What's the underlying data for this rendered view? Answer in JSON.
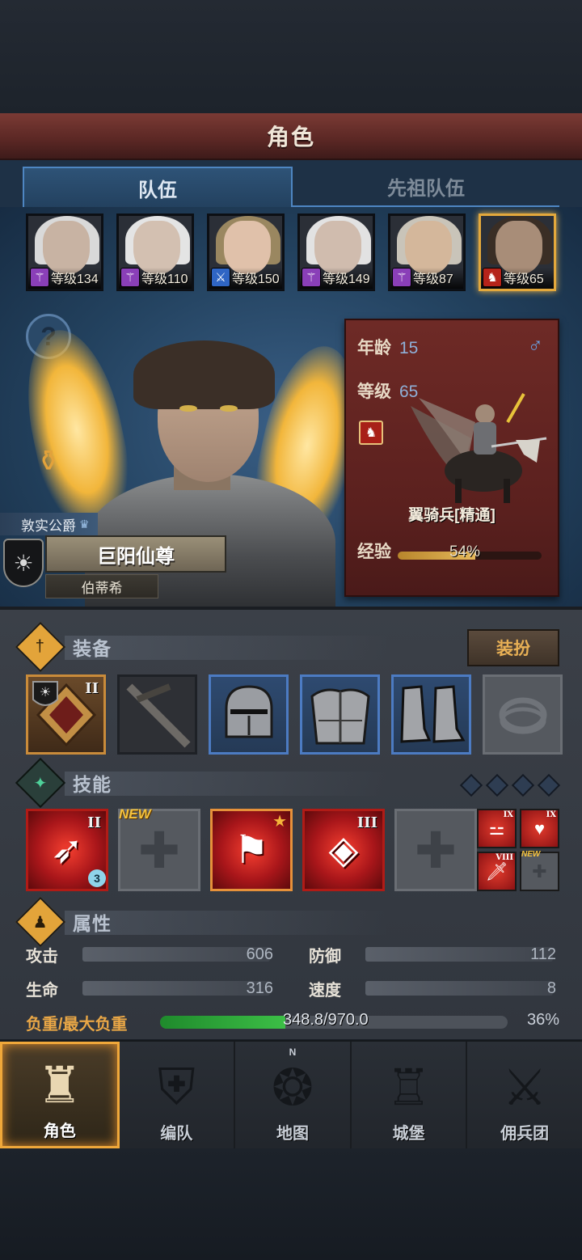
{
  "header": {
    "title": "角色"
  },
  "tabs": {
    "team": "队伍",
    "ancestor_team": "先祖队伍"
  },
  "roster": [
    {
      "level": "等级134",
      "class_icon": "staff-icon",
      "class_color": "#8a3fb8",
      "hair": "#d9d9d9",
      "skin": "#c8b3a3",
      "selected": false
    },
    {
      "level": "等级110",
      "class_icon": "staff-icon",
      "class_color": "#8a3fb8",
      "hair": "#e4e4e4",
      "skin": "#d3c0b1",
      "selected": false
    },
    {
      "level": "等级150",
      "class_icon": "sword-icon",
      "class_color": "#2f65c4",
      "hair": "#9a8760",
      "skin": "#e0c1aa",
      "selected": false
    },
    {
      "level": "等级149",
      "class_icon": "staff-icon",
      "class_color": "#8a3fb8",
      "hair": "#e2e2e2",
      "skin": "#d0bcae",
      "selected": false
    },
    {
      "level": "等级87",
      "class_icon": "staff-icon",
      "class_color": "#8a3fb8",
      "hair": "#c9c4b9",
      "skin": "#d4b79b",
      "selected": false
    },
    {
      "level": "等级65",
      "class_icon": "cavalry-icon",
      "class_color": "#b5231a",
      "hair": "#3a2e25",
      "skin": "#a88d78",
      "selected": true
    }
  ],
  "hero": {
    "title": "敦实公爵",
    "name": "巨阳仙尊",
    "subname": "伯蒂希"
  },
  "stats_banner": {
    "age_label": "年龄",
    "age": "15",
    "level_label": "等级",
    "level": "65",
    "unit_name": "翼骑兵[精通]",
    "exp_label": "经验",
    "exp_percent": "54%",
    "exp_fraction": 0.54
  },
  "equipment": {
    "title": "装备",
    "dress_button": "装扮",
    "slots": [
      {
        "name": "shield-slot",
        "roman": "II",
        "style": "gold"
      },
      {
        "name": "weapon-slot",
        "roman": "",
        "style": "dark"
      },
      {
        "name": "helmet-slot",
        "roman": "",
        "style": "blue"
      },
      {
        "name": "armor-slot",
        "roman": "",
        "style": "blue"
      },
      {
        "name": "boots-slot",
        "roman": "",
        "style": "blue"
      },
      {
        "name": "ring-slot",
        "roman": "",
        "style": "empty"
      }
    ]
  },
  "skills": {
    "title": "技能",
    "new_label": "NEW",
    "roman_2": "II",
    "roman_3": "III",
    "badge_3": "3",
    "mini_roman_9": "IX",
    "mini_roman_8": "VIII"
  },
  "attributes": {
    "title": "属性",
    "attack_label": "攻击",
    "attack": "606",
    "defense_label": "防御",
    "defense": "112",
    "hp_label": "生命",
    "hp": "316",
    "speed_label": "速度",
    "speed": "8",
    "load_label": "负重/最大负重",
    "load_value": "348.8/970.0",
    "load_percent": "36%",
    "load_fraction": 0.36
  },
  "nav": {
    "character": "角色",
    "formation": "编队",
    "map": "地图",
    "map_north": "N",
    "castle": "城堡",
    "mercenary": "佣兵团"
  },
  "colors": {
    "accent_gold": "#f0a83a",
    "banner_red": "#5a201e",
    "panel_blue": "#23425f"
  }
}
